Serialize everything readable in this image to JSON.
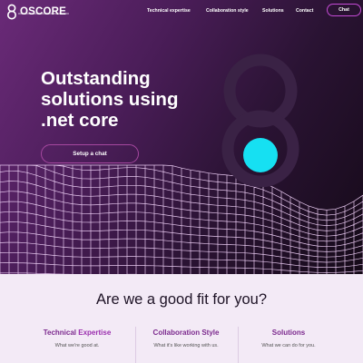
{
  "brand": {
    "name": "OSCORE"
  },
  "nav": {
    "items": [
      {
        "label": "Technical expertise"
      },
      {
        "label": "Collaboration style"
      },
      {
        "label": "Solutions"
      },
      {
        "label": "Contact"
      }
    ],
    "chat_label": "Chat"
  },
  "hero": {
    "headline_line1": "Outstanding",
    "headline_line2": "solutions using",
    "headline_line3": ".net core",
    "cta_label": "Setup a chat"
  },
  "fit": {
    "title": "Are we a good fit for you?",
    "columns": [
      {
        "title_part1": "Technical ",
        "title_part2": "Expertise",
        "subtitle": "What we're good at."
      },
      {
        "title": "Collaboration Style",
        "subtitle": "What it's like working with us."
      },
      {
        "title": "Solutions",
        "subtitle": "What we can do for you."
      }
    ]
  },
  "colors": {
    "accent": "#c54bd6",
    "cyan": "#16e0f2",
    "ring": "#3a2245",
    "section_bg": "#f3eaf6",
    "title_purple": "#7c2a8e"
  },
  "icons": {
    "logo": "oscore-8-logo-icon",
    "hero_graphic": "oscore-8-ring-icon"
  }
}
